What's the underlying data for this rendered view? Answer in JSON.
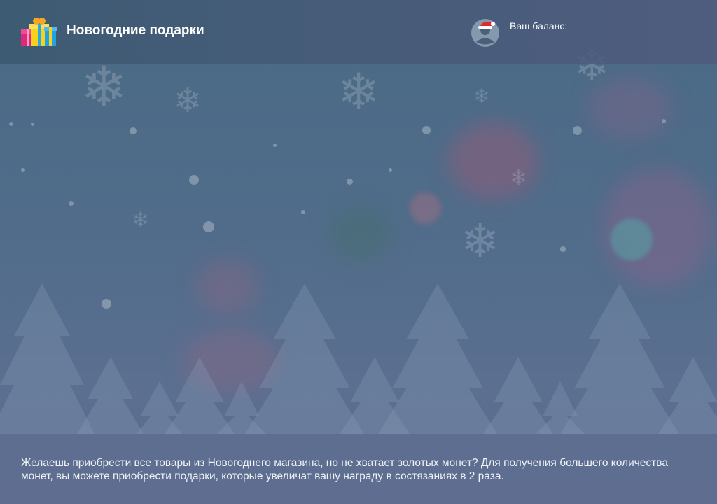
{
  "header": {
    "title": "Новогодние подарки",
    "balance_label": "Ваш баланс:",
    "balance_value": ""
  },
  "description": "Желаешь приобрести все товары из Новогоднего магазина, но не хватает золотых монет? Для получения большего количества монет, вы можете приобрести подарки, которые увеличат вашу награду в состязаниях в 2 раза.",
  "icons": {
    "logo": "gift-boxes-icon",
    "avatar": "santa-hat-avatar-icon",
    "snowflake": "snowflake-icon"
  },
  "colors": {
    "background": "#4f6b89",
    "header": "#425b74",
    "text": "#ffffff"
  }
}
